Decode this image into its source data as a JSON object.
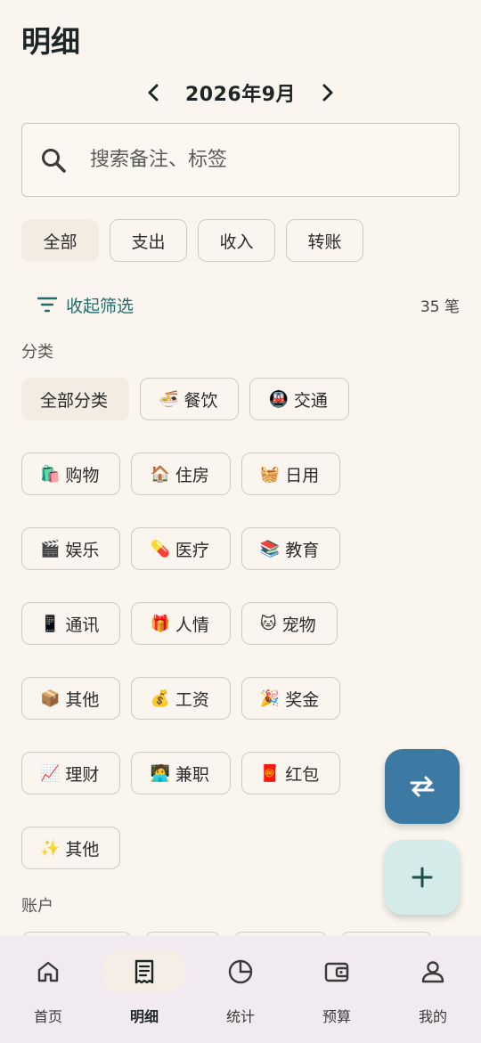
{
  "header": {
    "title": "明细"
  },
  "month_nav": {
    "label": "2026年9月"
  },
  "search": {
    "placeholder": "搜索备注、标签"
  },
  "type_tabs": [
    {
      "label": "全部",
      "selected": true
    },
    {
      "label": "支出",
      "selected": false
    },
    {
      "label": "收入",
      "selected": false
    },
    {
      "label": "转账",
      "selected": false
    }
  ],
  "filter": {
    "collapse_label": "收起筛选",
    "count_text": "35 笔"
  },
  "category_section": {
    "label": "分类"
  },
  "categories": [
    [
      {
        "emoji": "",
        "label": "全部分类",
        "selected": true
      },
      {
        "emoji": "🍜",
        "label": "餐饮"
      },
      {
        "emoji": "🚇",
        "label": "交通"
      }
    ],
    [
      {
        "emoji": "🛍️",
        "label": "购物"
      },
      {
        "emoji": "🏠",
        "label": "住房"
      },
      {
        "emoji": "🧺",
        "label": "日用"
      }
    ],
    [
      {
        "emoji": "🎬",
        "label": "娱乐"
      },
      {
        "emoji": "💊",
        "label": "医疗"
      },
      {
        "emoji": "📚",
        "label": "教育"
      }
    ],
    [
      {
        "emoji": "📱",
        "label": "通讯"
      },
      {
        "emoji": "🎁",
        "label": "人情"
      },
      {
        "emoji": "🐱",
        "label": "宠物"
      }
    ],
    [
      {
        "emoji": "📦",
        "label": "其他"
      },
      {
        "emoji": "💰",
        "label": "工资"
      },
      {
        "emoji": "🎉",
        "label": "奖金"
      }
    ],
    [
      {
        "emoji": "📈",
        "label": "理财"
      },
      {
        "emoji": "🧑‍💻",
        "label": "兼职"
      },
      {
        "emoji": "🧧",
        "label": "红包"
      }
    ],
    [
      {
        "emoji": "✨",
        "label": "其他"
      }
    ]
  ],
  "account_section": {
    "label": "账户"
  },
  "fabs": {
    "transfer_icon": "swap-arrows-icon",
    "add_icon": "plus-icon",
    "transfer_color": "#3d7aa3",
    "add_color": "#d5ebea"
  },
  "bottom_nav": [
    {
      "label": "首页",
      "icon": "home-icon",
      "active": false
    },
    {
      "label": "明细",
      "icon": "receipt-icon",
      "active": true
    },
    {
      "label": "统计",
      "icon": "pie-chart-icon",
      "active": false
    },
    {
      "label": "预算",
      "icon": "wallet-icon",
      "active": false
    },
    {
      "label": "我的",
      "icon": "person-icon",
      "active": false
    }
  ]
}
